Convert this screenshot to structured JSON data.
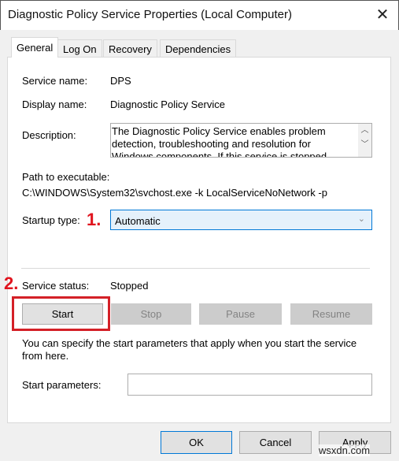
{
  "window": {
    "title": "Diagnostic Policy Service Properties (Local Computer)",
    "close_icon": "close-icon"
  },
  "tabs": [
    {
      "label": "General",
      "active": true
    },
    {
      "label": "Log On"
    },
    {
      "label": "Recovery"
    },
    {
      "label": "Dependencies"
    }
  ],
  "general": {
    "service_name_label": "Service name:",
    "service_name": "DPS",
    "display_name_label": "Display name:",
    "display_name": "Diagnostic Policy Service",
    "description_label": "Description:",
    "description": "The Diagnostic Policy Service enables problem detection, troubleshooting and resolution for Windows components.  If this service is stopped",
    "path_label": "Path to executable:",
    "path": "C:\\WINDOWS\\System32\\svchost.exe -k LocalServiceNoNetwork -p",
    "startup_type_label": "Startup type:",
    "startup_type": "Automatic",
    "service_status_label": "Service status:",
    "service_status": "Stopped",
    "buttons": {
      "start": "Start",
      "stop": "Stop",
      "pause": "Pause",
      "resume": "Resume"
    },
    "hint": "You can specify the start parameters that apply when you start the service from here.",
    "start_params_label": "Start parameters:",
    "start_params_value": ""
  },
  "annotations": {
    "step1": "1.",
    "step2": "2.",
    "color": "#e0141e"
  },
  "footer": {
    "ok": "OK",
    "cancel": "Cancel",
    "apply": "Apply"
  },
  "watermark": "wsxdn.com"
}
